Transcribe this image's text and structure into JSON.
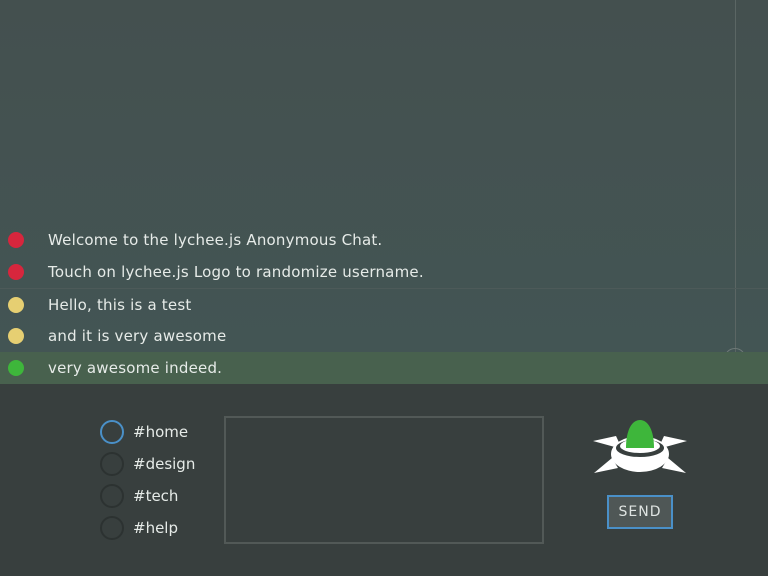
{
  "chat": {
    "messages": [
      {
        "text": "Welcome to the lychee.js Anonymous Chat.",
        "color": "#d7263d"
      },
      {
        "text": "Touch on lychee.js Logo to randomize username.",
        "color": "#d7263d"
      },
      {
        "text": "Hello, this is a test",
        "color": "#e6cf72"
      },
      {
        "text": "and it is very awesome",
        "color": "#e6cf72"
      },
      {
        "text": "very awesome indeed.",
        "color": "#3eb63b"
      }
    ]
  },
  "channels": [
    {
      "label": "#home",
      "selected": true
    },
    {
      "label": "#design",
      "selected": false
    },
    {
      "label": "#tech",
      "selected": false
    },
    {
      "label": "#help",
      "selected": false
    }
  ],
  "composer": {
    "value": "",
    "send_label": "SEND"
  },
  "logo": {
    "icon": "lychee-logo-icon",
    "color_top": "#3eb63b",
    "color_body": "#ffffff"
  },
  "colors": {
    "selected_channel": "#4a90c8",
    "highlight_row": "#48614e"
  }
}
